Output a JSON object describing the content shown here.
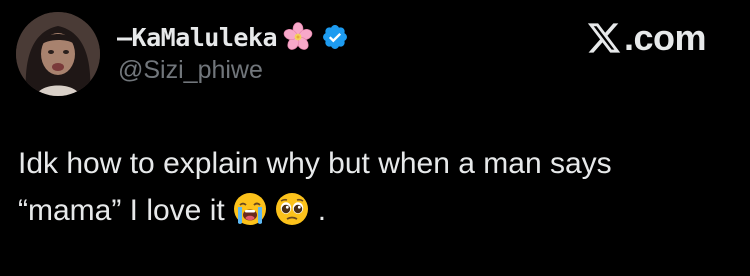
{
  "tweet": {
    "author": {
      "display_name": "—KaMaluleka",
      "handle": "@Sizi_phiwe",
      "name_emoji": "cherry-blossom-icon",
      "verified_icon": "verified-badge-icon",
      "verified_color": "#1d9bf0"
    },
    "brand": {
      "logo_icon": "x-logo-icon",
      "text": ".com"
    },
    "body": {
      "line1": "Idk how to explain why but when a man says",
      "line2_text": "“mama” I love it",
      "emoji_1": "loudly-crying-face-icon",
      "emoji_2": "pleading-face-icon",
      "trailing": "."
    }
  },
  "colors": {
    "background": "#000000",
    "text_primary": "#e7e9ea",
    "text_secondary": "#71767b",
    "accent": "#1d9bf0"
  }
}
